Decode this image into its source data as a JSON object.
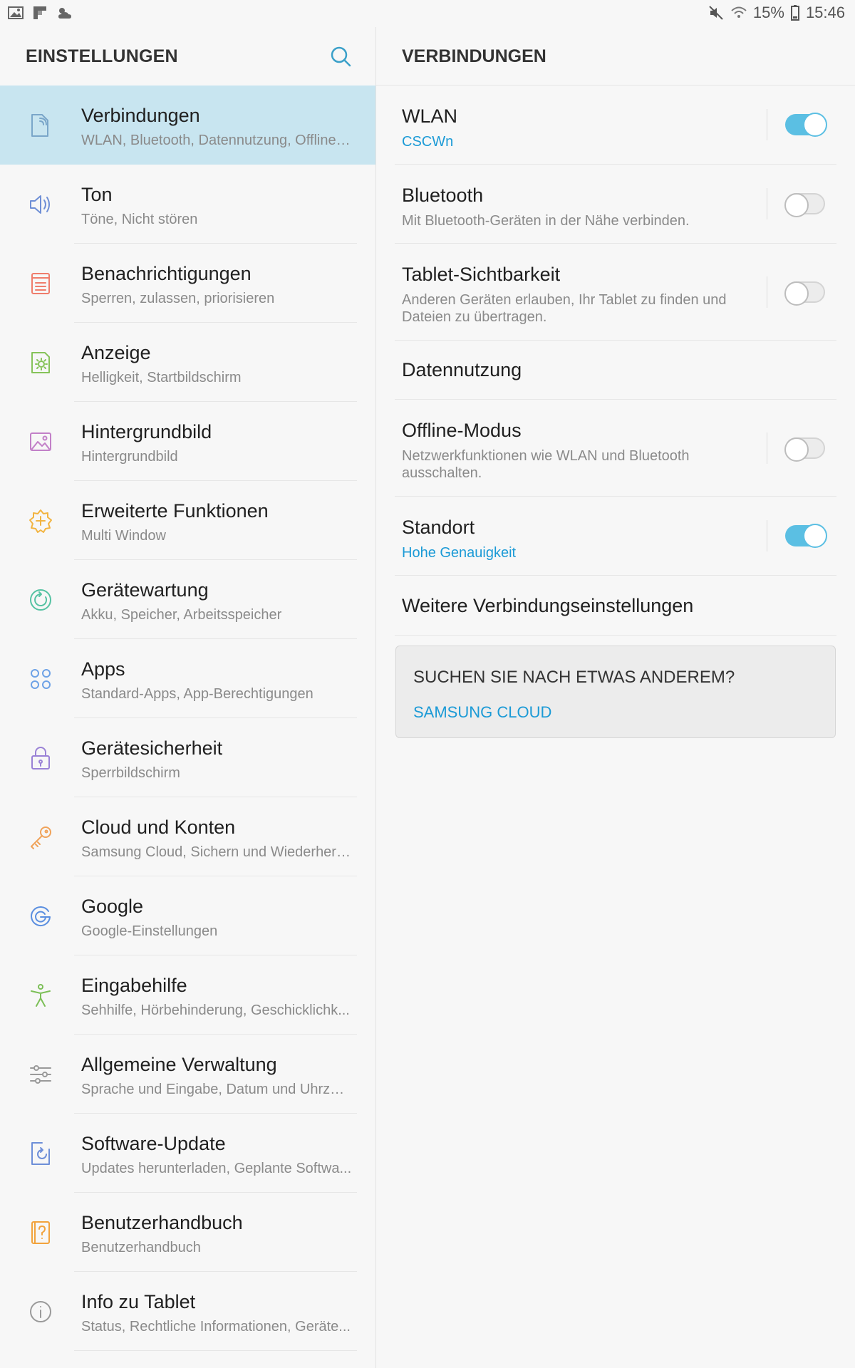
{
  "status_bar": {
    "left_icons": [
      "gallery-icon",
      "flipboard-icon",
      "weather-icon"
    ],
    "right_icons": [
      "mute-icon",
      "wifi-icon",
      "battery-icon"
    ],
    "battery": "15%",
    "time": "15:46"
  },
  "left_pane": {
    "title": "EINSTELLUNGEN",
    "search_icon": "search-icon",
    "items": [
      {
        "title": "Verbindungen",
        "subtitle": "WLAN, Bluetooth, Datennutzung, Offline-...",
        "icon": "connections-icon",
        "color": "#7aa6c9",
        "selected": true
      },
      {
        "title": "Ton",
        "subtitle": "Töne, Nicht stören",
        "icon": "sound-icon",
        "color": "#6f8fd6"
      },
      {
        "title": "Benachrichtigungen",
        "subtitle": "Sperren, zulassen, priorisieren",
        "icon": "notifications-icon",
        "color": "#ef7d6c"
      },
      {
        "title": "Anzeige",
        "subtitle": "Helligkeit, Startbildschirm",
        "icon": "display-icon",
        "color": "#86c35a"
      },
      {
        "title": "Hintergrundbild",
        "subtitle": "Hintergrundbild",
        "icon": "wallpaper-icon",
        "color": "#c280c8"
      },
      {
        "title": "Erweiterte Funktionen",
        "subtitle": "Multi Window",
        "icon": "advanced-features-icon",
        "color": "#f2b441"
      },
      {
        "title": "Gerätewartung",
        "subtitle": "Akku, Speicher, Arbeitsspeicher",
        "icon": "device-maintenance-icon",
        "color": "#55c2a2"
      },
      {
        "title": "Apps",
        "subtitle": "Standard-Apps, App-Berechtigungen",
        "icon": "apps-icon",
        "color": "#6ea2e6"
      },
      {
        "title": "Gerätesicherheit",
        "subtitle": "Sperrbildschirm",
        "icon": "lock-icon",
        "color": "#9a82d6"
      },
      {
        "title": "Cloud und Konten",
        "subtitle": "Samsung Cloud, Sichern und Wiederhers...",
        "icon": "key-icon",
        "color": "#f0a35a"
      },
      {
        "title": "Google",
        "subtitle": "Google-Einstellungen",
        "icon": "google-icon",
        "color": "#5b8fe0"
      },
      {
        "title": "Eingabehilfe",
        "subtitle": "Sehhilfe, Hörbehinderung, Geschicklichk...",
        "icon": "accessibility-icon",
        "color": "#7cbf57"
      },
      {
        "title": "Allgemeine Verwaltung",
        "subtitle": "Sprache und Eingabe, Datum und Uhrzeit...",
        "icon": "sliders-icon",
        "color": "#9a9a9a"
      },
      {
        "title": "Software-Update",
        "subtitle": "Updates herunterladen, Geplante Softwa...",
        "icon": "software-update-icon",
        "color": "#6e8fd8"
      },
      {
        "title": "Benutzerhandbuch",
        "subtitle": "Benutzerhandbuch",
        "icon": "user-manual-icon",
        "color": "#f2a33d"
      },
      {
        "title": "Info zu Tablet",
        "subtitle": "Status, Rechtliche Informationen, Geräte...",
        "icon": "info-icon",
        "color": "#9a9a9a"
      }
    ]
  },
  "right_pane": {
    "title": "VERBINDUNGEN",
    "rows": [
      {
        "title": "WLAN",
        "subtitle": "CSCWn",
        "subtitle_style": "blue",
        "toggle": true
      },
      {
        "title": "Bluetooth",
        "subtitle": "Mit Bluetooth-Geräten in der Nähe verbinden.",
        "toggle": false
      },
      {
        "title": "Tablet-Sichtbarkeit",
        "subtitle": "Anderen Geräten erlauben, Ihr Tablet zu finden und Dateien zu übertragen.",
        "toggle": false
      },
      {
        "title": "Datennutzung"
      },
      {
        "title": "Offline-Modus",
        "subtitle": "Netzwerkfunktionen wie WLAN und Bluetooth ausschalten.",
        "toggle": false
      },
      {
        "title": "Standort",
        "subtitle": "Hohe Genauigkeit",
        "subtitle_style": "blue",
        "toggle": true
      },
      {
        "title": "Weitere Verbindungseinstellungen"
      }
    ],
    "suggestion": {
      "title": "SUCHEN SIE NACH ETWAS ANDEREM?",
      "link": "SAMSUNG CLOUD"
    }
  },
  "colors": {
    "accent": "#1b9ad6",
    "toggle_on": "#5bbfe3",
    "selected_bg": "#c8e5f0"
  }
}
